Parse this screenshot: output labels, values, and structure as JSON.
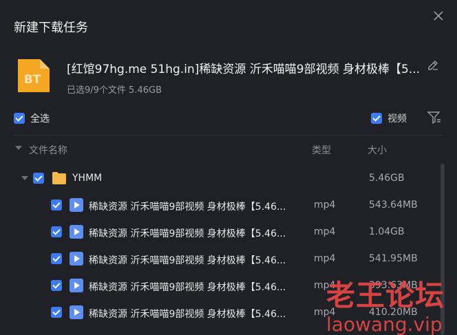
{
  "dialog": {
    "title": "新建下载任务"
  },
  "task": {
    "icon_label": "BT",
    "name": "[红馆97hg.me 51hg.in]稀缺资源 沂禾喵喵9部视频 身材极棒【5...",
    "summary": "已选9/9个文件 5.46GB"
  },
  "controls": {
    "select_all_label": "全选",
    "video_filter_label": "视频"
  },
  "table": {
    "columns": {
      "name": "文件名称",
      "type": "类型",
      "size": "大小"
    },
    "folder": {
      "name": "YHMM",
      "size": "5.46GB"
    },
    "files": [
      {
        "name": "稀缺资源 沂禾喵喵9部视频 身材极棒【5.46...",
        "type": "mp4",
        "size": "543.64MB"
      },
      {
        "name": "稀缺资源 沂禾喵喵9部视频 身材极棒【5.46...",
        "type": "mp4",
        "size": "1.04GB"
      },
      {
        "name": "稀缺资源 沂禾喵喵9部视频 身材极棒【5.46...",
        "type": "mp4",
        "size": "541.95MB"
      },
      {
        "name": "稀缺资源 沂禾喵喵9部视频 身材极棒【5.46...",
        "type": "mp4",
        "size": "393.63MB"
      },
      {
        "name": "稀缺资源 沂禾喵喵9部视频 身材极棒【5.46...",
        "type": "mp4",
        "size": "410.20MB"
      }
    ]
  },
  "watermark": {
    "cn": "老王论坛",
    "en": "laowang.vip"
  },
  "colors": {
    "background": "#202126",
    "checkbox": "#3d7cf0",
    "bt_icon": "#f5a623",
    "folder": "#f2b84b",
    "watermark": "#e54646"
  }
}
